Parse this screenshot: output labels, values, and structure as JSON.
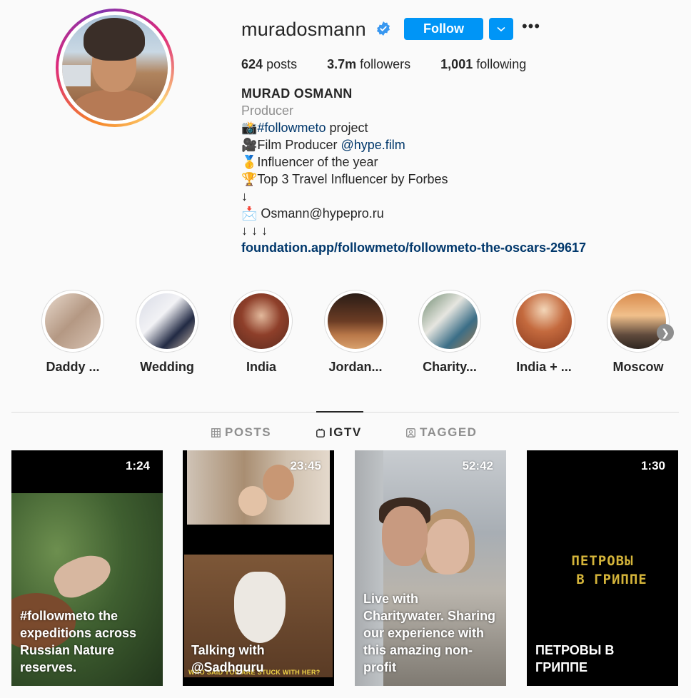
{
  "profile": {
    "username": "muradosmann",
    "follow_label": "Follow",
    "more_label": "•••",
    "stats": {
      "posts_count": "624",
      "posts_label": "posts",
      "followers_count": "3.7m",
      "followers_label": "followers",
      "following_count": "1,001",
      "following_label": "following"
    },
    "bio": {
      "full_name": "MURAD OSMANN",
      "category": "Producer",
      "line1_emoji": "📸",
      "line1_tag": "#followmeto",
      "line1_text": " project",
      "line2_emoji": "🎥",
      "line2_text": "Film Producer ",
      "line2_mention": "@hype.film",
      "line3_emoji": "🥇",
      "line3_text": "Influencer of the year",
      "line4_emoji": "🏆",
      "line4_text": "Top 3 Travel Influencer by Forbes",
      "line5": "↓",
      "line6_emoji": "📩",
      "line6_text": " Osmann@hypepro.ru",
      "line7": "↓ ↓ ↓",
      "external_link": "foundation.app/followmeto/followmeto-the-oscars-29617"
    }
  },
  "highlights": [
    {
      "label": "Daddy ..."
    },
    {
      "label": "Wedding"
    },
    {
      "label": "India"
    },
    {
      "label": "Jordan..."
    },
    {
      "label": "Charity..."
    },
    {
      "label": "India + ..."
    },
    {
      "label": "Moscow"
    }
  ],
  "tabs": {
    "posts": "POSTS",
    "igtv": "IGTV",
    "tagged": "TAGGED"
  },
  "igtv": [
    {
      "duration": "1:24",
      "caption": "#followmeto the expeditions across Russian Nature reserves."
    },
    {
      "duration": "23:45",
      "caption": "Talking with @Sadhguru",
      "subtitle": "WHO SAID YOU ARE STUCK WITH HER?"
    },
    {
      "duration": "52:42",
      "caption": "Live with Charitywater. Sharing our experience with this amazing non-profit"
    },
    {
      "duration": "1:30",
      "caption": "ПЕТРОВЫ В ГРИППЕ",
      "poster_title_1": "ПЕТРОВЫ",
      "poster_title_2": "В ГРИППЕ"
    }
  ],
  "colors": {
    "accent": "#0095f6",
    "link": "#00376b",
    "muted": "#8e8e8e",
    "text": "#262626"
  }
}
